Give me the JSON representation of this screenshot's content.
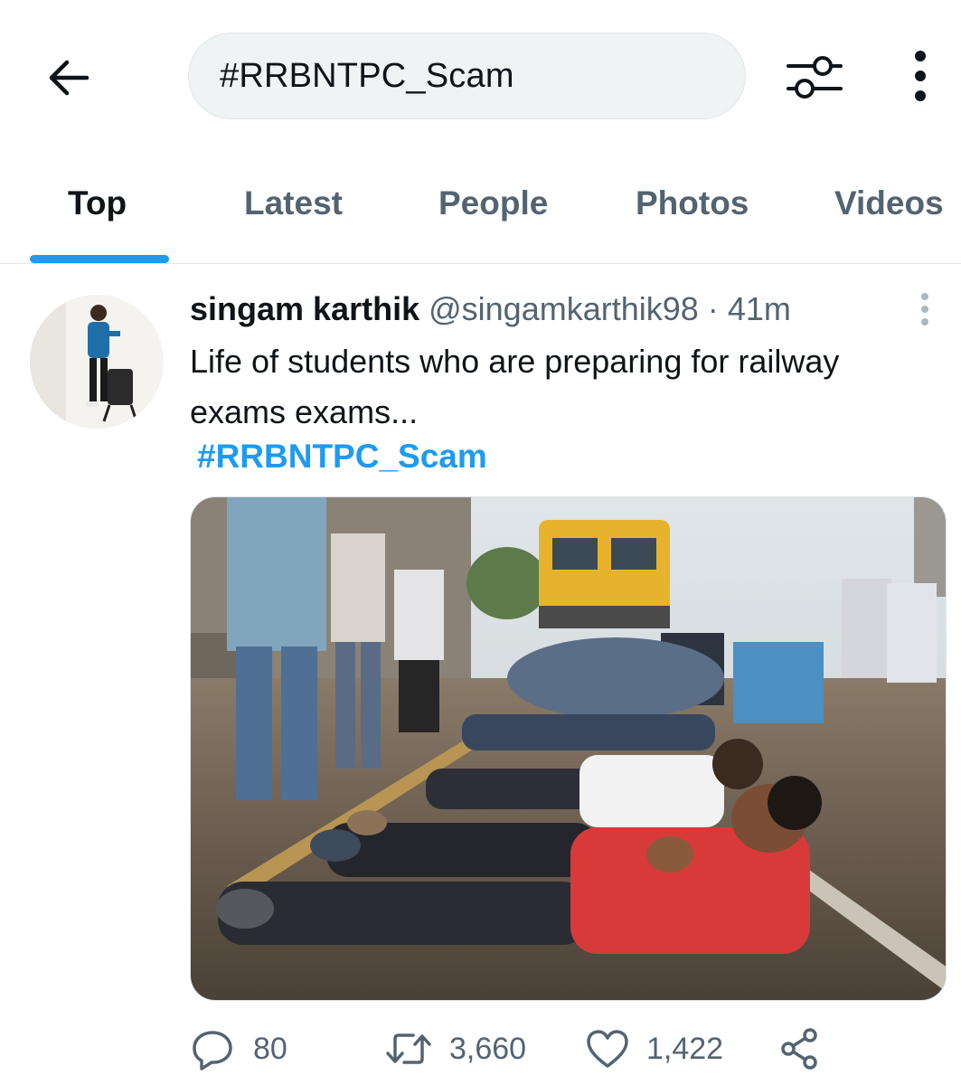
{
  "search": {
    "query": "#RRBNTPC_Scam"
  },
  "tabs": [
    {
      "label": "Top",
      "active": true
    },
    {
      "label": "Latest",
      "active": false
    },
    {
      "label": "People",
      "active": false
    },
    {
      "label": "Photos",
      "active": false
    },
    {
      "label": "Videos",
      "active": false
    }
  ],
  "tweet": {
    "author_name": "singam karthik",
    "handle": "@singamkarthik98",
    "separator": "·",
    "time": "41m",
    "text": "Life of students who are preparing for railway exams exams...",
    "hashtag": "#RRBNTPC_Scam",
    "stats": {
      "replies": "80",
      "retweets": "3,660",
      "likes": "1,422"
    }
  },
  "icons": {
    "back": "arrow-left-icon",
    "filter": "sliders-icon",
    "more": "vertical-ellipsis-icon",
    "reply": "speech-bubble-icon",
    "retweet": "retweet-icon",
    "like": "heart-icon",
    "share": "share-icon"
  },
  "colors": {
    "accent": "#1d9bf0",
    "text_primary": "#0f1419",
    "text_secondary": "#536471",
    "search_bg": "#eff3f4"
  }
}
